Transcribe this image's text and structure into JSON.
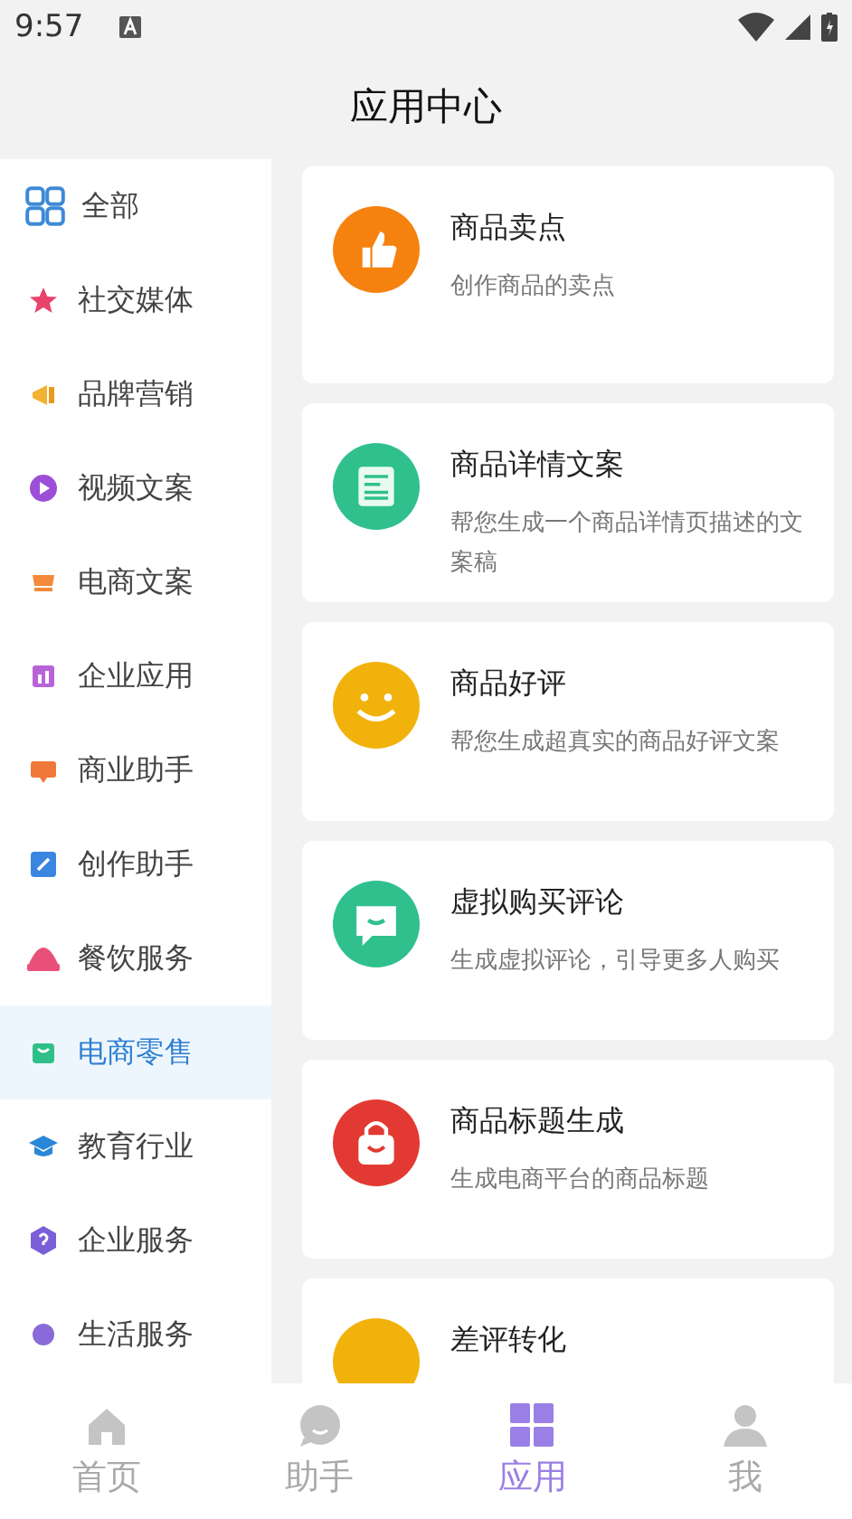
{
  "status_bar": {
    "time": "9:57"
  },
  "header": {
    "title": "应用中心"
  },
  "sidebar": {
    "items": [
      {
        "label": "全部",
        "selected": false
      },
      {
        "label": "社交媒体",
        "selected": false
      },
      {
        "label": "品牌营销",
        "selected": false
      },
      {
        "label": "视频文案",
        "selected": false
      },
      {
        "label": "电商文案",
        "selected": false
      },
      {
        "label": "企业应用",
        "selected": false
      },
      {
        "label": "商业助手",
        "selected": false
      },
      {
        "label": "创作助手",
        "selected": false
      },
      {
        "label": "餐饮服务",
        "selected": false
      },
      {
        "label": "电商零售",
        "selected": true
      },
      {
        "label": "教育行业",
        "selected": false
      },
      {
        "label": "企业服务",
        "selected": false
      },
      {
        "label": "生活服务",
        "selected": false
      }
    ]
  },
  "cards": [
    {
      "title": "商品卖点",
      "description": "创作商品的卖点"
    },
    {
      "title": "商品详情文案",
      "description": "帮您生成一个商品详情页描述的文案稿"
    },
    {
      "title": "商品好评",
      "description": "帮您生成超真实的商品好评文案"
    },
    {
      "title": "虚拟购买评论",
      "description": "生成虚拟评论，引导更多人购买"
    },
    {
      "title": "商品标题生成",
      "description": "生成电商平台的商品标题"
    },
    {
      "title": "差评转化"
    }
  ],
  "tab_bar": {
    "tabs": [
      {
        "label": "首页",
        "selected": false
      },
      {
        "label": "助手",
        "selected": false
      },
      {
        "label": "应用",
        "selected": true
      },
      {
        "label": "我",
        "selected": false
      }
    ]
  }
}
